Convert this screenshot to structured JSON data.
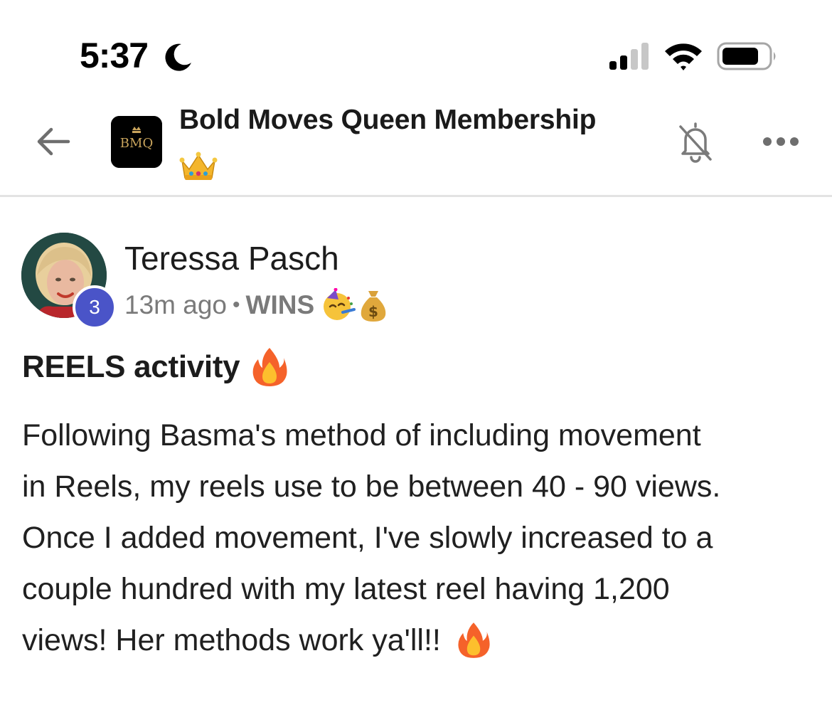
{
  "status_bar": {
    "time": "5:37"
  },
  "header": {
    "group_name": "Bold Moves Queen Membership",
    "logo_text": "BMQ"
  },
  "post": {
    "author": "Teressa Pasch",
    "level": "3",
    "time_ago": "13m ago",
    "separator": "•",
    "category": "WINS",
    "title": "REELS activity",
    "body_lines": [
      "Following Basma's method of including movement",
      "in Reels, my reels use to be between 40 - 90 views.",
      "Once I added movement, I've slowly increased to a",
      "couple hundred with my latest reel having 1,200",
      "views! Her methods work ya'll!!"
    ]
  },
  "icons": [
    "moon-icon",
    "signal-icon",
    "wifi-icon",
    "battery-icon",
    "back-arrow-icon",
    "crown-emoji",
    "bell-muted-icon",
    "more-icon",
    "party-face-emoji",
    "money-bag-emoji",
    "fire-emoji"
  ],
  "colors": {
    "level_badge": "#4a54c8",
    "meta_text": "#7a7a7a",
    "divider": "#e3e3e3"
  }
}
